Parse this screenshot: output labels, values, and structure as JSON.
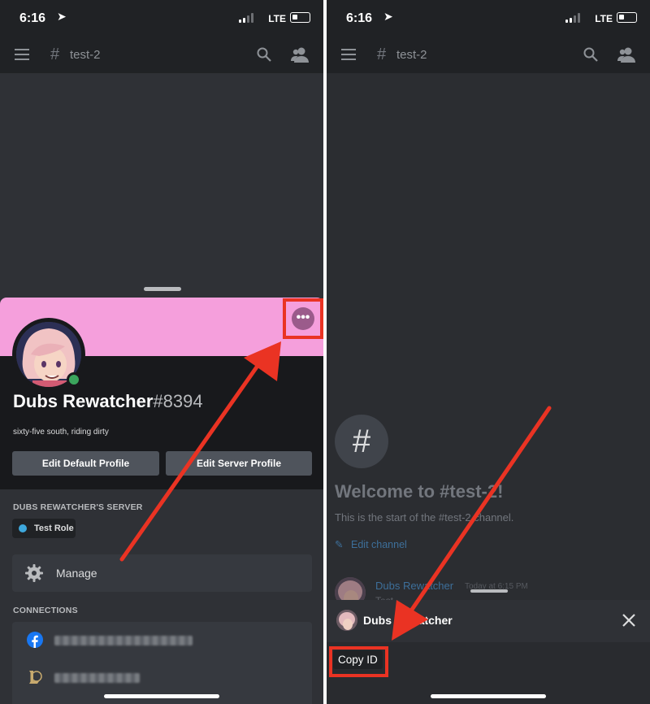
{
  "status": {
    "time": "6:16",
    "network": "LTE"
  },
  "channel": {
    "hash": "#",
    "name": "test-2"
  },
  "profile": {
    "display_name": "Dubs Rewatcher",
    "discriminator": "#8394",
    "bio": "sixty-five south, riding dirty",
    "edit_default_label": "Edit Default Profile",
    "edit_server_label": "Edit Server Profile",
    "more_label": "•••",
    "server_section": "DUBS REWATCHER'S SERVER",
    "role": {
      "name": "Test Role",
      "color": "#3ea8dc"
    },
    "manage_label": "Manage",
    "connections_section": "CONNECTIONS",
    "banner_color": "#f59fdc"
  },
  "chat": {
    "channel_icon": "#",
    "welcome_title": "Welcome to #test-2!",
    "welcome_sub": "This is the start of the #test-2 channel.",
    "edit_channel_label": "Edit channel",
    "message": {
      "author": "Dubs Rewatcher",
      "time": "Today at 6:15 PM",
      "text": "Test"
    }
  },
  "action_sheet": {
    "user_name": "Dubs Rewatcher",
    "copy_id_label": "Copy ID",
    "close_icon": "close-icon"
  },
  "annotation": {
    "color": "#ea3323"
  }
}
